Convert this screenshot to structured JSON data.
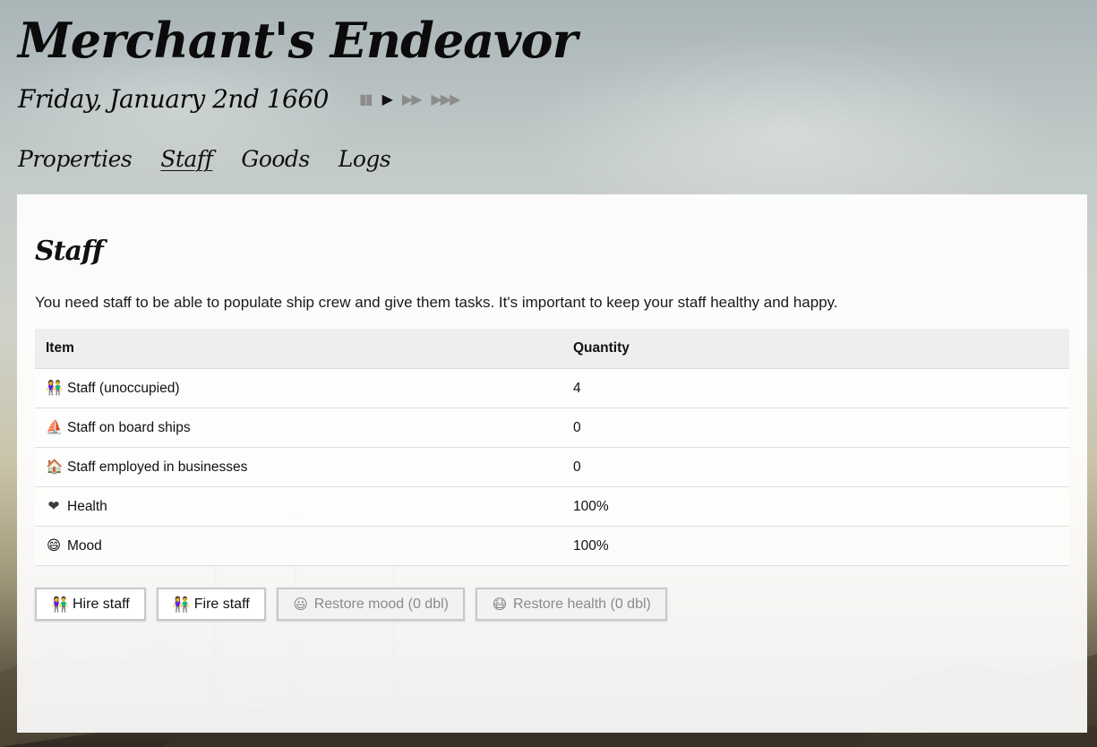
{
  "app_title": "Merchant's Endeavor",
  "game_date": "Friday, January 2nd 1660",
  "speed_controls": [
    {
      "icon": "pause-icon",
      "glyph": "▮▮",
      "active": false
    },
    {
      "icon": "play-icon",
      "glyph": "▶",
      "active": true
    },
    {
      "icon": "fast-forward-icon",
      "glyph": "▶▶",
      "active": false
    },
    {
      "icon": "fastest-forward-icon",
      "glyph": "▶▶▶",
      "active": false
    }
  ],
  "nav": {
    "properties": "Properties",
    "staff": "Staff",
    "goods": "Goods",
    "logs": "Logs"
  },
  "section": {
    "title": "Staff",
    "description": "You need staff to be able to populate ship crew and give them tasks. It's important to keep your staff healthy and happy."
  },
  "table": {
    "headers": {
      "item": "Item",
      "quantity": "Quantity"
    },
    "rows": [
      {
        "icon": "people-holding-hands-icon",
        "glyph": "👫",
        "label": "Staff (unoccupied)",
        "value": "4"
      },
      {
        "icon": "sailboat-icon",
        "glyph": "⛵",
        "label": "Staff on board ships",
        "value": "0"
      },
      {
        "icon": "house-icon",
        "glyph": "🏠",
        "label": "Staff employed in businesses",
        "value": "0"
      },
      {
        "icon": "black-heart-icon",
        "glyph": "❤",
        "label": "Health",
        "value": "100%"
      },
      {
        "icon": "smiling-face-icon",
        "glyph": "😄",
        "label": "Mood",
        "value": "100%"
      }
    ]
  },
  "actions": {
    "hire": {
      "icon": "people-holding-hands-icon",
      "glyph": "👫",
      "label": "Hire staff"
    },
    "fire": {
      "icon": "people-holding-hands-icon",
      "glyph": "👫",
      "label": "Fire staff"
    },
    "restore_mood": {
      "icon": "smiley-icon",
      "glyph": "😃",
      "label": "Restore mood (0 dbl)"
    },
    "restore_health": {
      "icon": "medical-mask-icon",
      "glyph": "😷",
      "label": "Restore health (0 dbl)"
    }
  },
  "colors": {
    "panel_bg": "#ffffff",
    "table_header_bg": "#eeeeee",
    "text": "#111111",
    "muted": "#8a8a8a",
    "heart": "#3a3a3a",
    "emoji_yellow": "#f2c744"
  }
}
